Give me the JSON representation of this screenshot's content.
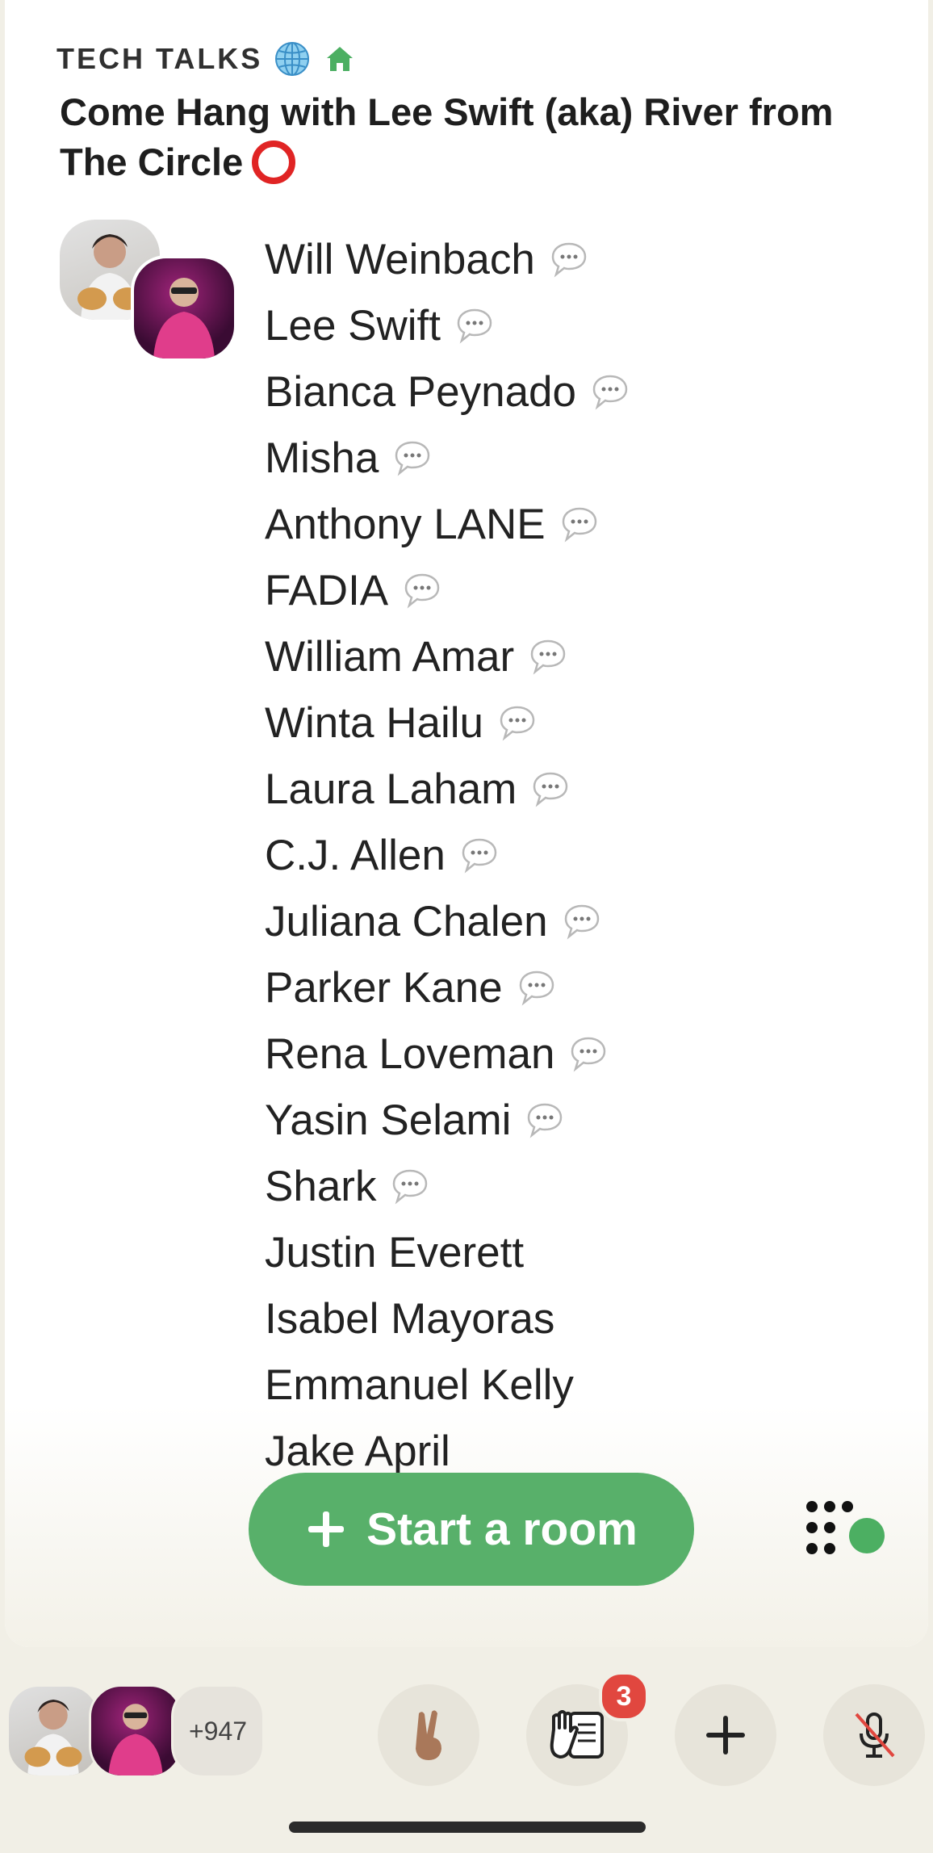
{
  "club": {
    "name": "TECH TALKS",
    "icons": [
      "globe-icon",
      "home-icon"
    ]
  },
  "room": {
    "title": "Come Hang with Lee Swift (aka) River from The Circle",
    "title_icon": "red-circle-icon"
  },
  "speakers": [
    {
      "name": "Will Weinbach",
      "chat": true
    },
    {
      "name": "Lee Swift",
      "chat": true
    },
    {
      "name": "Bianca Peynado",
      "chat": true
    },
    {
      "name": "Misha",
      "chat": true
    },
    {
      "name": "Anthony LANE",
      "chat": true
    },
    {
      "name": "FADIA",
      "chat": true
    },
    {
      "name": "William Amar",
      "chat": true
    },
    {
      "name": "Winta Hailu",
      "chat": true
    },
    {
      "name": "Laura Laham",
      "chat": true
    },
    {
      "name": "C.J. Allen",
      "chat": true
    },
    {
      "name": "Juliana Chalen",
      "chat": true
    },
    {
      "name": "Parker Kane",
      "chat": true
    },
    {
      "name": "Rena Loveman",
      "chat": true
    },
    {
      "name": "Yasin Selami",
      "chat": true
    },
    {
      "name": "Shark",
      "chat": true
    },
    {
      "name": "Justin Everett",
      "chat": false
    },
    {
      "name": "Isabel Mayoras",
      "chat": false
    },
    {
      "name": "Emmanuel Kelly",
      "chat": false
    },
    {
      "name": "Jake April",
      "chat": false
    }
  ],
  "start_room": {
    "label": "Start a room"
  },
  "bottom_bar": {
    "listener_count": "+947",
    "hand_badge": "3",
    "buttons": [
      "peace-hand-icon",
      "raise-hand-icon",
      "plus-icon",
      "mic-muted-icon"
    ]
  },
  "colors": {
    "accent_green": "#58b06a",
    "badge_red": "#e1473f",
    "background": "#f1efe6"
  }
}
